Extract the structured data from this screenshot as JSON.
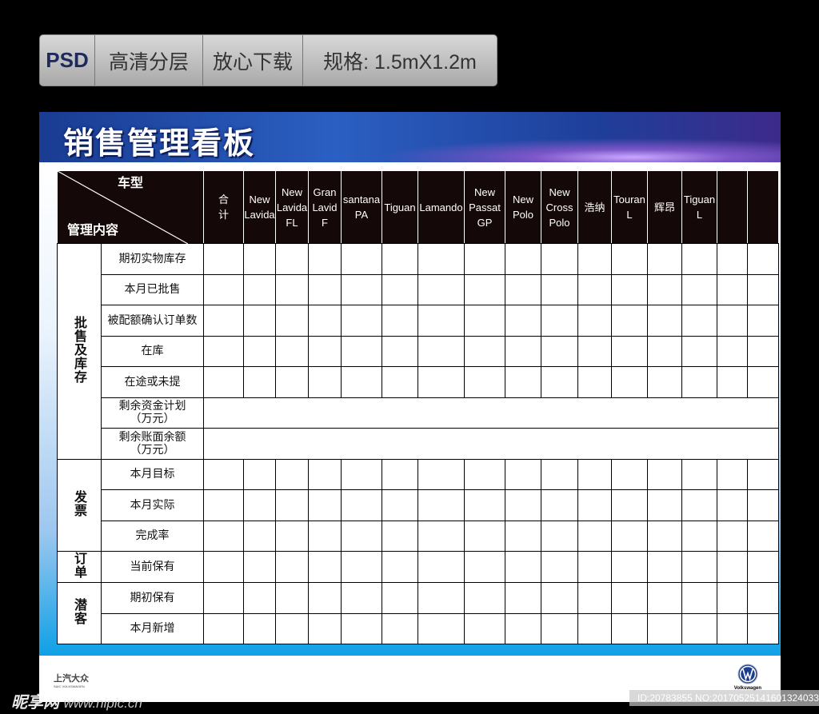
{
  "promo": {
    "psd": "PSD",
    "s1": "高清分层",
    "s2": "放心下载",
    "s3": "规格: 1.5mX1.2m"
  },
  "title": "销售管理看板",
  "header": {
    "top": "车型",
    "bottom": "管理内容",
    "columns": [
      "合\n计",
      "New\nLavida",
      "New\nLavida\nFL",
      "Gran\nLavid\nF",
      "santana\nPA",
      "Tiguan",
      "Lamando",
      "New\nPassat\nGP",
      "New\nPolo",
      "New\nCross\nPolo",
      "浩纳",
      "Touran\nL",
      "辉昂",
      "Tiguan\nL",
      "",
      ""
    ]
  },
  "groups": [
    {
      "label": "批售及库存",
      "items": [
        "期初实物库存",
        "本月已批售",
        "被配额确认订单数",
        "在库",
        "在途或未提",
        "剩余资金计划\n（万元）",
        "剩余账面余额\n（万元）"
      ],
      "merged": [
        5,
        6
      ]
    },
    {
      "label": "发票",
      "items": [
        "本月目标",
        "本月实际",
        "完成率"
      ],
      "merged": []
    },
    {
      "label": "订单",
      "items": [
        "当前保有"
      ],
      "merged": []
    },
    {
      "label": "潜客",
      "items": [
        "期初保有",
        "本月新增"
      ],
      "merged": []
    }
  ],
  "footer": {
    "left_logo": "上汽大众",
    "left_logo_sub": "SAIC VOLKSWAGEN",
    "right_logo": "Volkswagen"
  },
  "watermark": {
    "brand": "昵享网",
    "url": "www.nipic.cn",
    "id": "ID:20783855 NO:20170525141601324033"
  },
  "colors": {
    "header_bg": "#150808",
    "banner": "#1e3f9a",
    "bottom_blue": "#0ea0e6"
  }
}
